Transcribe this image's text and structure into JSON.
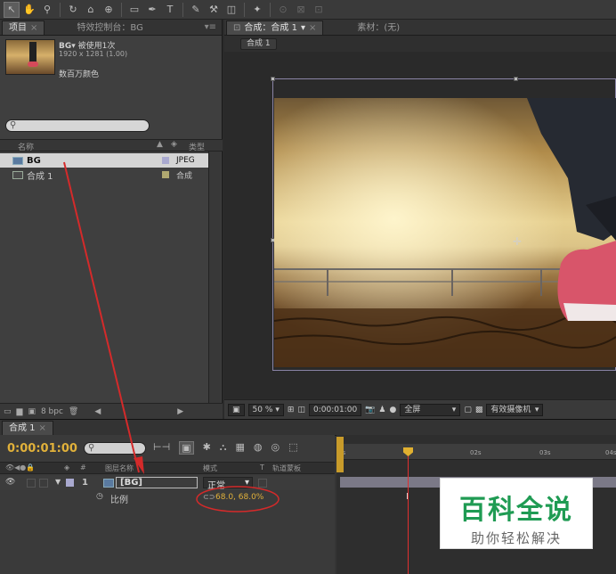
{
  "project_panel": {
    "tab_project": "项目",
    "tab_effects": "特效控制台：BG",
    "selected_item": {
      "name": "BG▾",
      "used_text": "被使用1次",
      "dimensions": "1920 x 1281 (1.00)",
      "colors": "数百万颜色"
    },
    "search_placeholder": "",
    "col_name": "名称",
    "col_type": "类型",
    "items": [
      {
        "name": "BG",
        "type": "JPEG"
      },
      {
        "name": "合成 1",
        "type": "合成"
      }
    ],
    "bpc": "8 bpc"
  },
  "comp_panel": {
    "tab_comp": "合成：合成 1",
    "tab_footage": "素材：(无)",
    "breadcrumb": "合成 1",
    "zoom": "50 %",
    "timecode": "0:00:01:00",
    "resolution": "全屏",
    "camera": "有效摄像机"
  },
  "timeline": {
    "tab": "合成 1",
    "timecode": "0:00:01:00",
    "col_layer_name": "图层名称",
    "col_mode": "模式",
    "col_t": "T",
    "col_track_matte": "轨道蒙板",
    "col_hash": "#",
    "layer": {
      "index": "1",
      "name": "[BG]",
      "mode": "正常"
    },
    "property": {
      "name": "比例",
      "value": "68.0, 68.0%"
    },
    "ruler_ticks": [
      "0s",
      "02s",
      "03s",
      "04s"
    ]
  },
  "watermark": {
    "title": "百科全说",
    "subtitle": "助你轻松解决"
  },
  "colors": {
    "timecode": "#e1b13a",
    "annotation": "#d42a2a",
    "watermark_green": "#1f9b53"
  }
}
